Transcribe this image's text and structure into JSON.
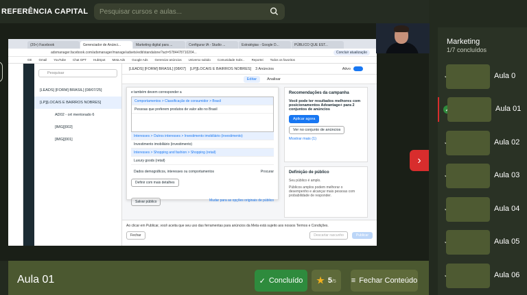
{
  "brand": "REFERÊNCIA CAPITAL",
  "search": {
    "placeholder": "Pesquisar cursos e aulas..."
  },
  "browser": {
    "tabs": [
      "(20+) Facebook",
      "Gerenciador de Anúnci...",
      "Marketing digital para ...",
      "Configurar IA - Studio ...",
      "Estratégias - Google D...",
      "PÚBLICO QUE EST..."
    ],
    "url": "adsmanager.facebook.com/adsmanager/manage/adsets/edit/standalone?act=5784478710204...",
    "update_label": "Concluir atualização",
    "bookmarks": [
      "GE",
      "Gmail",
      "YouTube",
      "Chat GPT",
      "HubSpot",
      "Meta Ads",
      "Google Ads",
      "Gerenciar anúncios",
      "Universo subido",
      "Comunidade Sobr...",
      "Reportei",
      "Todos os favoritos"
    ]
  },
  "ads": {
    "tree_search": "Pesquisar",
    "tree": [
      "[LEADS] [FORM] BRASIL] [08/07/25]",
      "[LP][LOCAIS E BAIRROS NOBRES]",
      "AD02 - ort mentorado 6",
      "[IMG][002]",
      "[IMG][001]"
    ],
    "breadcrumb": [
      "[LEADS] [FORM] BRASIL] [08/07]",
      "[LP][LOCAIS E BAIRROS NOBRES]",
      "3 Anúncios"
    ],
    "status": "Ativo",
    "edit": "Editar",
    "review": "Analisar",
    "popup": {
      "intro": "e também devem corresponder a",
      "lines": [
        "Comportamentos > Classificação de consumidor > Brasil",
        "Pessoas que preferem produtos de valor alto no Brasil",
        "Interesses > Outros interesses > Investimento imobiliário (investimento)",
        "Investimento imobiliário (investimento)",
        "Interesses > Shopping and fashion > Shopping (retail)",
        "Luxury goods (retail)"
      ],
      "search_hint": "Dados demográficos, interesses ou comportamentos",
      "browse": "Procurar",
      "define_more": "Definir com mais detalhes",
      "save": "Salvar público",
      "change": "Mudar para as opções originais de público"
    },
    "rec": {
      "title": "Recomendações da campanha",
      "body": "Você pode ter resultados melhores com posicionamentos Advantage+ para 2 conjuntos de anúncios",
      "apply": "Aplicar agora",
      "see": "Ver no conjunto de anúncios",
      "more": "Mostrar mais (1)"
    },
    "def": {
      "title": "Definição de público",
      "l1": "Seu público é amplo.",
      "l2": "Públicos amplos podem melhorar o desempenho e alcançar mais pessoas com probabilidade de responder."
    },
    "footer": {
      "text": "Ao clicar em Publicar, você aceita que seu uso das ferramentas para anúncios da Meta está sujeito aos nossos Termos e Condições.",
      "close": "Fechar",
      "discard": "Descartar rascunho",
      "publish": "Publicar"
    }
  },
  "lesson": {
    "title": "Aula 01",
    "done_label": "Concluído",
    "rating": "5",
    "rating_max": "/5",
    "close_label": "Fechar Conteúdo"
  },
  "sidebar": {
    "course": "Marketing",
    "progress": "1/7 concluídos",
    "lessons": [
      {
        "name": "Aula 0",
        "state": "check"
      },
      {
        "name": "Aula 01",
        "state": "completed"
      },
      {
        "name": "Aula 02",
        "state": "check"
      },
      {
        "name": "Aula 03",
        "state": "check"
      },
      {
        "name": "Aula 04",
        "state": "check"
      },
      {
        "name": "Aula 05",
        "state": "check"
      },
      {
        "name": "Aula 06",
        "state": "check"
      }
    ]
  },
  "colors": {
    "accent_red": "#d82d2d",
    "done_green": "#2e8b3d",
    "olive": "#4b5830"
  }
}
